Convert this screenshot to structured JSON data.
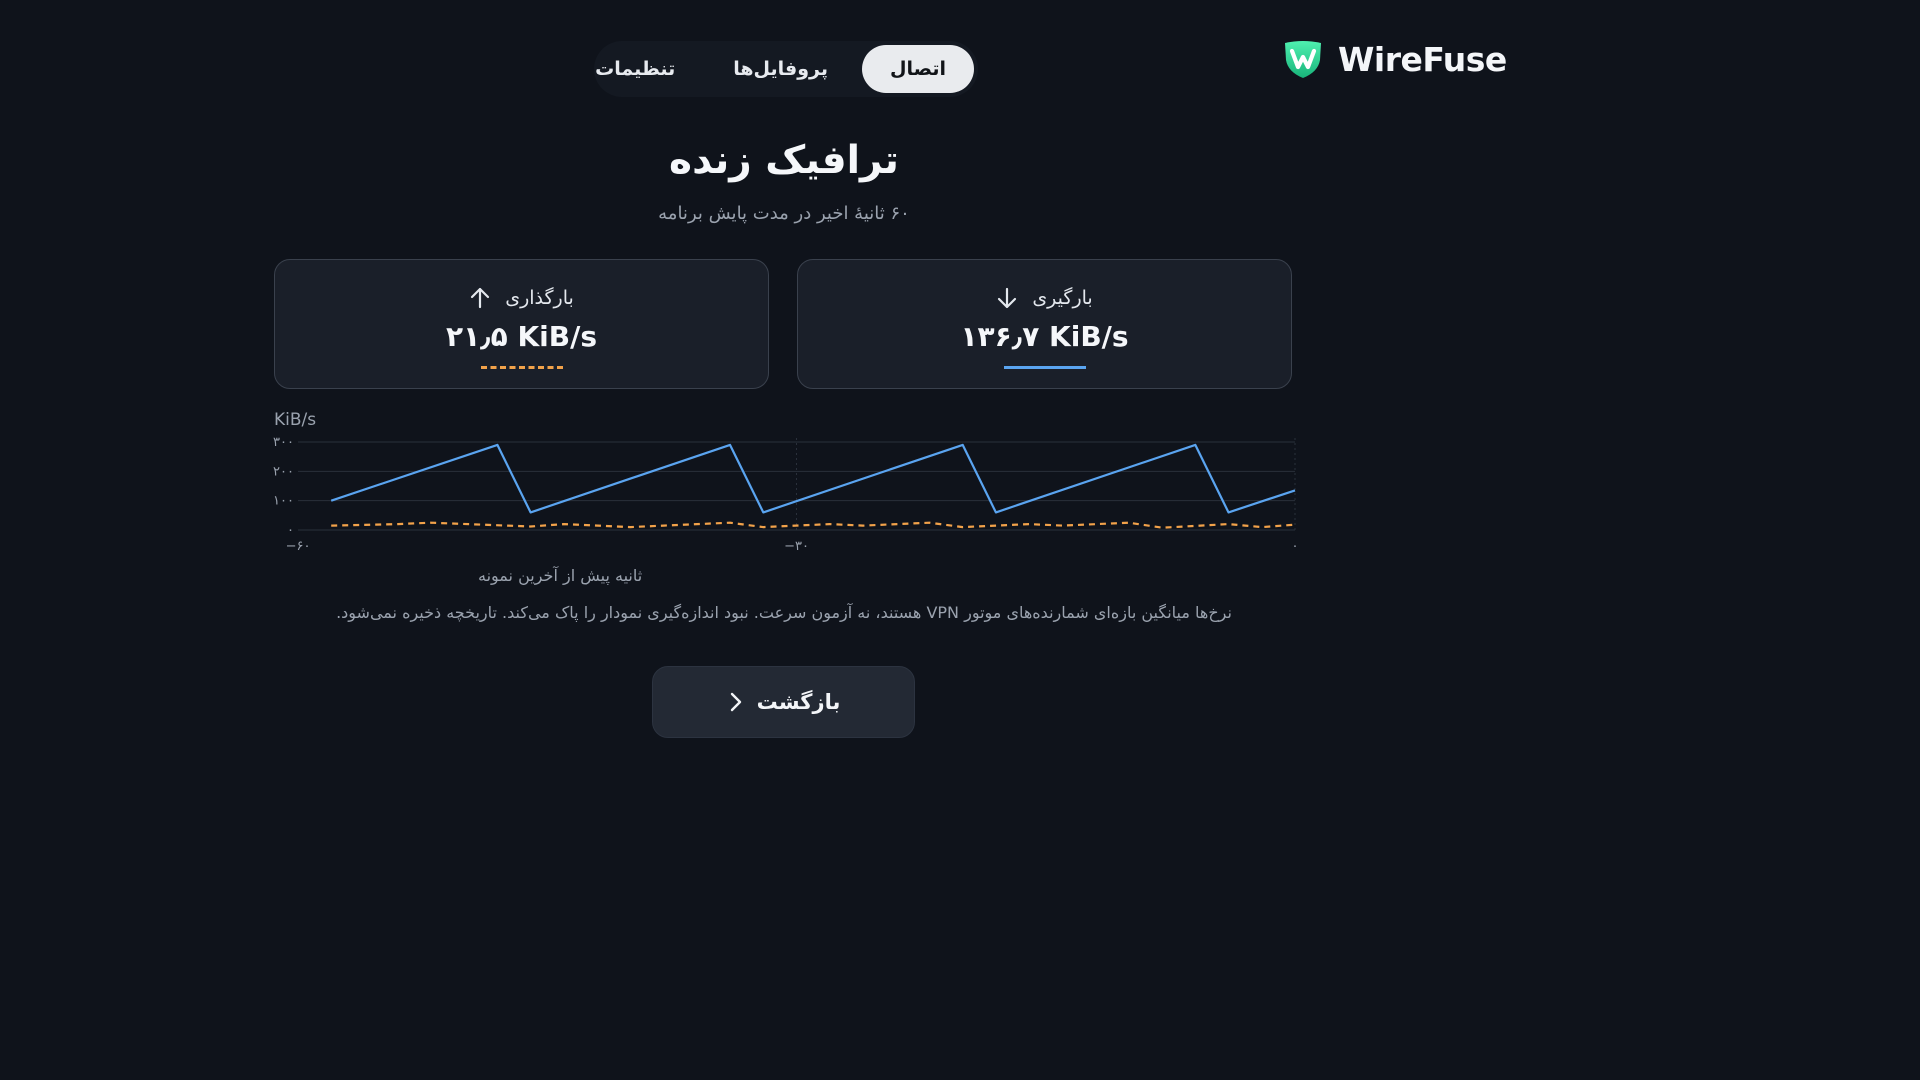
{
  "brand": {
    "name": "WireFuse",
    "icon": "wirefuse-logo-icon",
    "accent": "#3ddc84"
  },
  "nav": {
    "tabs": [
      {
        "label": "اتصال",
        "active": true
      },
      {
        "label": "پروفایل‌ها",
        "active": false
      },
      {
        "label": "تنظیمات",
        "active": false
      }
    ]
  },
  "page": {
    "title": "ترافیک زنده",
    "subtitle": "۶۰ ثانیهٔ اخیر در مدت پایش برنامه"
  },
  "cards": {
    "upload": {
      "label": "بارگذاری",
      "value": "۲۱٫۵ KiB/s",
      "icon": "arrow-up-icon",
      "color": "#f2a24a",
      "line_style": "dashed"
    },
    "download": {
      "label": "بارگیری",
      "value": "۱۳۶٫۷ KiB/s",
      "icon": "arrow-down-icon",
      "color": "#5aa4f0",
      "line_style": "solid"
    }
  },
  "chart_data": {
    "type": "line",
    "ylabel": "KiB/s",
    "xlabel": "ثانیه پیش از آخرین نمونه",
    "ylim": [
      0,
      300
    ],
    "xlim": [
      -60,
      0
    ],
    "y_ticks": [
      {
        "value": 0,
        "label": "۰"
      },
      {
        "value": 100,
        "label": "۱۰۰"
      },
      {
        "value": 200,
        "label": "۲۰۰"
      },
      {
        "value": 300,
        "label": "۳۰۰"
      }
    ],
    "x_ticks": [
      {
        "value": -60,
        "label": "−۶۰"
      },
      {
        "value": -30,
        "label": "−۳۰"
      },
      {
        "value": 0,
        "label": "۰"
      }
    ],
    "grid": true,
    "series": [
      {
        "key": "download",
        "color": "#5aa4f0",
        "style": "solid",
        "x": [
          -58,
          -48,
          -46,
          -34,
          -32,
          -20,
          -18,
          -6,
          -4,
          0
        ],
        "y": [
          100,
          290,
          60,
          290,
          60,
          290,
          60,
          290,
          60,
          135
        ]
      },
      {
        "key": "upload",
        "color": "#f2a24a",
        "style": "dashed",
        "x": [
          -58,
          -54,
          -52,
          -46,
          -44,
          -40,
          -38,
          -34,
          -32,
          -28,
          -26,
          -22,
          -20,
          -16,
          -14,
          -10,
          -8,
          -4,
          -2,
          0
        ],
        "y": [
          15,
          20,
          25,
          12,
          20,
          10,
          15,
          25,
          10,
          20,
          15,
          25,
          10,
          20,
          15,
          25,
          8,
          20,
          10,
          18
        ]
      }
    ]
  },
  "footer": {
    "note": "نرخ‌ها میانگین بازه‌ای شمارنده‌های موتور VPN هستند، نه آزمون سرعت. نبود اندازه‌گیری نمودار را پاک می‌کند. تاریخچه ذخیره نمی‌شود.",
    "back_label": "بازگشت",
    "back_icon": "chevron-right-icon"
  }
}
